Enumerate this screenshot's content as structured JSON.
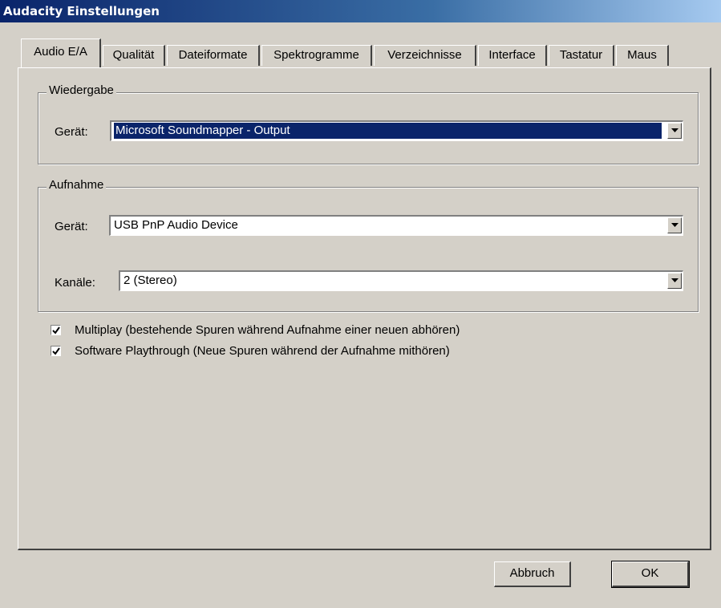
{
  "window": {
    "title": "Audacity Einstellungen"
  },
  "tabs": [
    {
      "label": "Audio E/A"
    },
    {
      "label": "Qualität"
    },
    {
      "label": "Dateiformate"
    },
    {
      "label": "Spektrogramme"
    },
    {
      "label": "Verzeichnisse"
    },
    {
      "label": "Interface"
    },
    {
      "label": "Tastatur"
    },
    {
      "label": "Maus"
    }
  ],
  "playback": {
    "group_label": "Wiedergabe",
    "device_label": "Gerät:",
    "device_value": "Microsoft Soundmapper - Output"
  },
  "recording": {
    "group_label": "Aufnahme",
    "device_label": "Gerät:",
    "device_value": "USB PnP Audio Device",
    "channels_label": "Kanäle:",
    "channels_value": "2 (Stereo)"
  },
  "options": [
    {
      "label": "Multiplay (bestehende Spuren während Aufnahme einer neuen abhören)",
      "checked": true
    },
    {
      "label": "Software Playthrough (Neue Spuren während der Aufnahme mithören)",
      "checked": true
    }
  ],
  "buttons": {
    "cancel": "Abbruch",
    "ok": "OK"
  }
}
